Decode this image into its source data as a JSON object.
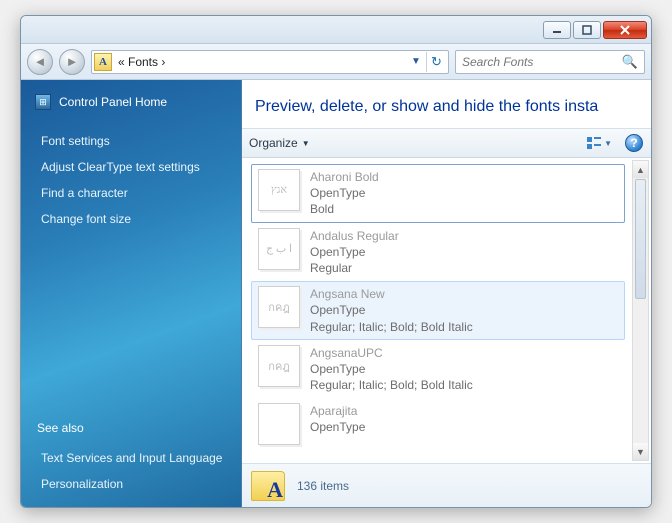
{
  "titlebar": {},
  "nav": {
    "breadcrumb": "«  Fonts  ›",
    "search_placeholder": "Search Fonts"
  },
  "sidebar": {
    "home": "Control Panel Home",
    "links": [
      "Font settings",
      "Adjust ClearType text settings",
      "Find a character",
      "Change font size"
    ],
    "see_also_label": "See also",
    "see_also": [
      "Text Services and Input Language",
      "Personalization"
    ]
  },
  "content": {
    "heading": "Preview, delete, or show and hide the fonts insta",
    "organize_label": "Organize",
    "fonts": [
      {
        "name": "Aharoni Bold",
        "type": "OpenType",
        "style": "Bold",
        "thumb": "אגץ",
        "state": "selected",
        "multi": false,
        "faded": true
      },
      {
        "name": "Andalus Regular",
        "type": "OpenType",
        "style": "Regular",
        "thumb": "ا ب ج",
        "state": "",
        "multi": false,
        "faded": true
      },
      {
        "name": "Angsana New",
        "type": "OpenType",
        "style": "Regular; Italic; Bold; Bold Italic",
        "thumb": "กคฎ",
        "state": "hover",
        "multi": true,
        "faded": true
      },
      {
        "name": "AngsanaUPC",
        "type": "OpenType",
        "style": "Regular; Italic; Bold; Bold Italic",
        "thumb": "กคฎ",
        "state": "",
        "multi": true,
        "faded": true
      },
      {
        "name": "Aparajita",
        "type": "OpenType",
        "style": "",
        "thumb": "",
        "state": "",
        "multi": true,
        "faded": true
      }
    ],
    "status_count": "136 items"
  }
}
